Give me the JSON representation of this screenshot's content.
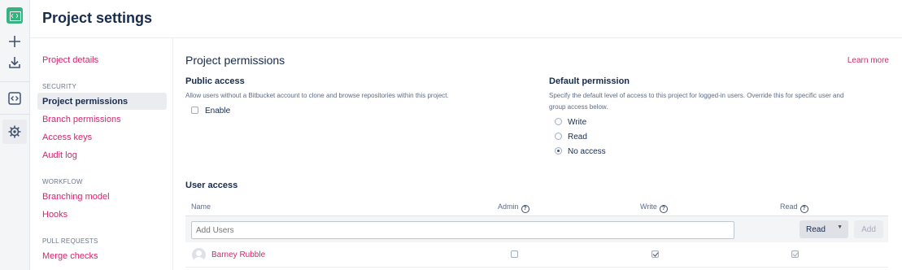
{
  "rail": {
    "icons": [
      "project-logo-icon",
      "plus-icon",
      "download-icon",
      "code-icon",
      "gear-icon"
    ]
  },
  "header": {
    "title": "Project settings"
  },
  "sidebar": {
    "project_details": "Project details",
    "security_heading": "SECURITY",
    "security_items": [
      {
        "label": "Project permissions",
        "active": true
      },
      {
        "label": "Branch permissions"
      },
      {
        "label": "Access keys"
      },
      {
        "label": "Audit log"
      }
    ],
    "workflow_heading": "WORKFLOW",
    "workflow_items": [
      {
        "label": "Branching model"
      },
      {
        "label": "Hooks"
      }
    ],
    "pull_requests_heading": "PULL REQUESTS",
    "pull_requests_items": [
      {
        "label": "Merge checks"
      }
    ]
  },
  "main": {
    "title": "Project permissions",
    "learn_more": "Learn more",
    "public_access": {
      "title": "Public access",
      "description": "Allow users without a Bitbucket account to clone and browse repositories within this project.",
      "enable_label": "Enable",
      "enabled": false
    },
    "default_permission": {
      "title": "Default permission",
      "description_line1": "Specify the default level of access to this project for logged-in users. Override this for specific user and",
      "description_line2": "group access below.",
      "options": [
        "Write",
        "Read",
        "No access"
      ],
      "selected": "No access"
    },
    "user_access": {
      "title": "User access",
      "columns": [
        "Name",
        "Admin",
        "Write",
        "Read"
      ],
      "add_users_placeholder": "Add Users",
      "permission_select": "Read",
      "add_button": "Add",
      "users": [
        {
          "name": "Barney Rubble",
          "admin": false,
          "write": true,
          "read": true
        }
      ]
    }
  },
  "colors": {
    "link": "#d6246e",
    "logo": "#36b37e",
    "text": "#172b4d",
    "muted": "#5e6c84"
  }
}
